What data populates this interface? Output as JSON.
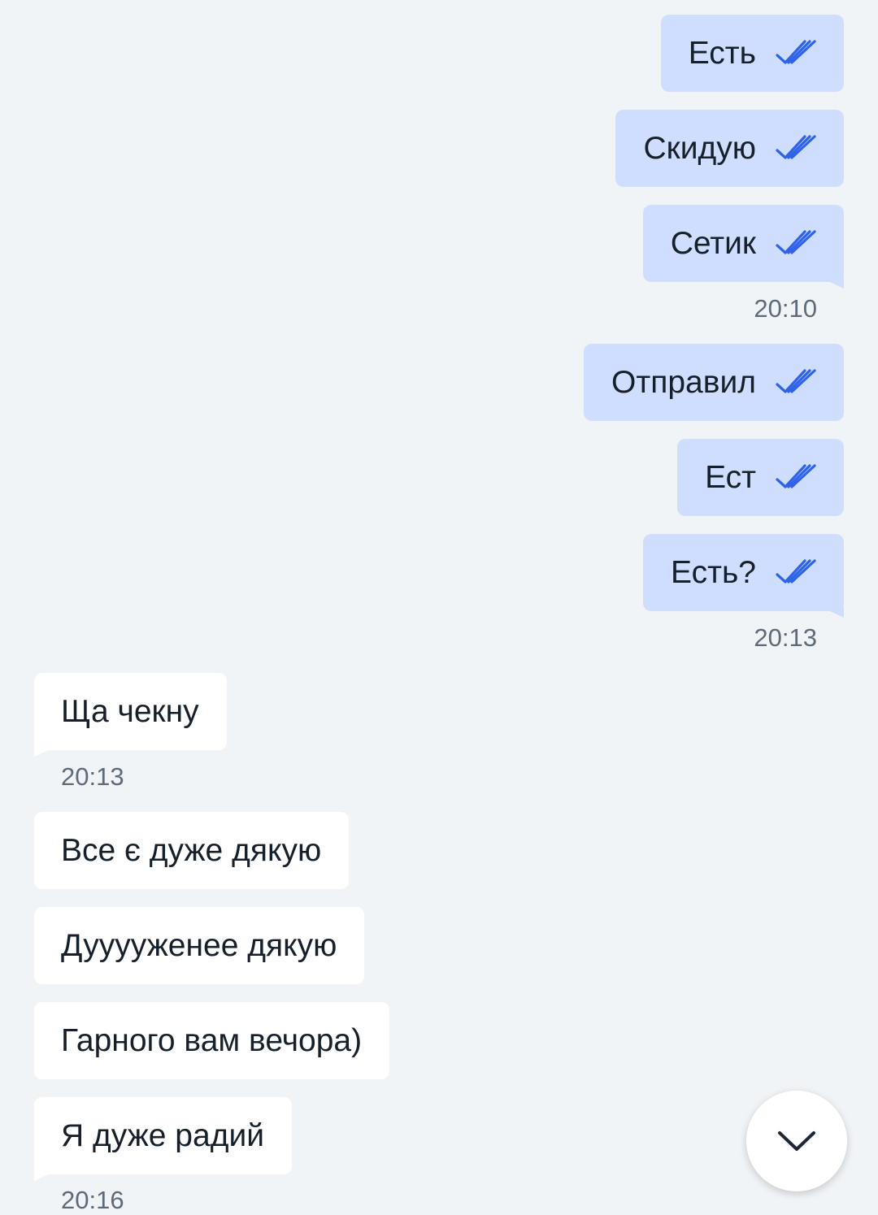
{
  "messages": {
    "m1": {
      "text": "Есть",
      "status": "read-double-check"
    },
    "m2": {
      "text": "Скидую",
      "status": "read-double-check"
    },
    "m3": {
      "text": "Сетик",
      "status": "read-double-check",
      "time": "20:10"
    },
    "m4": {
      "text": "Отправил",
      "status": "read-double-check"
    },
    "m5": {
      "text": "Ест",
      "status": "read-double-check"
    },
    "m6": {
      "text": "Есть?",
      "status": "read-double-check",
      "time": "20:13"
    },
    "m7": {
      "text": "Ща чекну",
      "time": "20:13"
    },
    "m8": {
      "text": "Все є дуже дякую"
    },
    "m9": {
      "text": "Дууууженее дякую"
    },
    "m10": {
      "text": "Гарного вам вечора)"
    },
    "m11": {
      "text": "Я дуже радий",
      "time": "20:16"
    }
  },
  "colors": {
    "background": "#f1f4f7",
    "outgoing_bubble": "#cfdeff",
    "incoming_bubble": "#ffffff",
    "check_color": "#2f63e8",
    "text": "#16202b",
    "time_text": "#5d6b78"
  },
  "icons": {
    "read_status": "double-check-icon",
    "scroll_down": "chevron-down-icon"
  }
}
